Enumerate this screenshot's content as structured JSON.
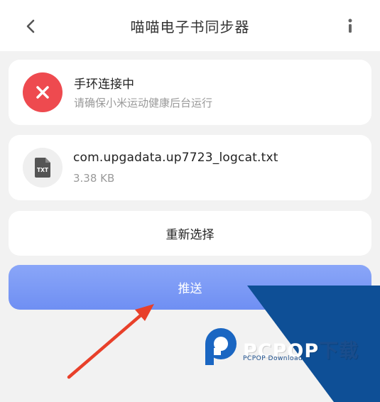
{
  "header": {
    "title": "喵喵电子书同步器",
    "back_icon": "chevron-left-icon",
    "more_icon": "more-vertical-icon"
  },
  "status": {
    "title": "手环连接中",
    "subtitle": "请确保小米运动健康后台运行",
    "icon": "close-icon",
    "icon_color": "#ee4a4f"
  },
  "file": {
    "icon": "txt-file-icon",
    "icon_label": "TXT",
    "name": "com.upgadata.up7723_logcat.txt",
    "size": "3.38 KB"
  },
  "actions": {
    "reselect_label": "重新选择",
    "push_label": "推送",
    "push_color": "#7b98f5"
  },
  "watermark": {
    "brand_main": "PCPOP",
    "brand_suffix": "下载",
    "brand_sub": "PCPOP Download",
    "color": "#1a4d8c"
  },
  "annotation": {
    "arrow_color": "#e8402a"
  }
}
